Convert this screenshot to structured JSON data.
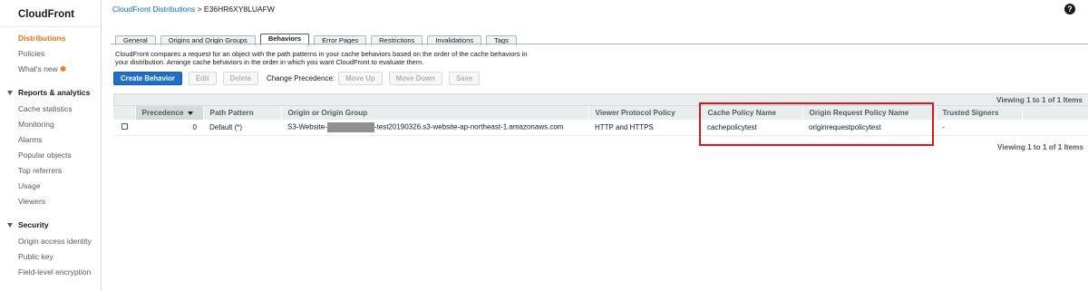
{
  "sidebar": {
    "title": "CloudFront",
    "items": [
      {
        "label": "Distributions",
        "active": true
      },
      {
        "label": "Policies"
      },
      {
        "label": "What's new",
        "badge": "✱"
      }
    ],
    "reports": {
      "label": "Reports & analytics",
      "items": [
        "Cache statistics",
        "Monitoring",
        "Alarms",
        "Popular objects",
        "Top referrers",
        "Usage",
        "Viewers"
      ]
    },
    "security": {
      "label": "Security",
      "items": [
        "Origin access identity",
        "Public key",
        "Field-level encryption"
      ]
    }
  },
  "breadcrumb": {
    "link": "CloudFront Distributions",
    "separator": ">",
    "current": "E36HR6XY8LUAFW"
  },
  "help_icon": "?",
  "tabs": [
    "General",
    "Origins and Origin Groups",
    "Behaviors",
    "Error Pages",
    "Restrictions",
    "Invalidations",
    "Tags"
  ],
  "active_tab": "Behaviors",
  "description": "CloudFront compares a request for an object with the path patterns in your cache behaviors based on the order of the cache behaviors in your distribution. Arrange cache behaviors in the order in which you want CloudFront to evaluate them.",
  "toolbar": {
    "create": "Create Behavior",
    "edit": "Edit",
    "delete": "Delete",
    "precedence_label": "Change Precedence:",
    "move_up": "Move Up",
    "move_down": "Move Down",
    "save": "Save"
  },
  "table": {
    "viewing_top": "Viewing 1 to 1 of 1 Items",
    "viewing_bottom": "Viewing 1 to 1 of 1 Items",
    "columns": [
      "",
      "Precedence",
      "Path Pattern",
      "Origin or Origin Group",
      "Viewer Protocol Policy",
      "Cache Policy Name",
      "Origin Request Policy Name",
      "Trusted Signers",
      ""
    ],
    "rows": [
      {
        "precedence": "0",
        "path_pattern": "Default (*)",
        "origin_prefix": "S3-Website-",
        "origin_suffix": "-test20190326.s3-website-ap-northeast-1.amazonaws.com",
        "viewer_protocol": "HTTP and HTTPS",
        "cache_policy": "cachepolicytest",
        "origin_request_policy": "originrequestpolicytest",
        "trusted_signers": "-"
      }
    ]
  },
  "colors": {
    "accent": "#ec7211",
    "primary_button": "#1d6fc7",
    "link": "#0073bb",
    "highlight": "#e0131e"
  }
}
